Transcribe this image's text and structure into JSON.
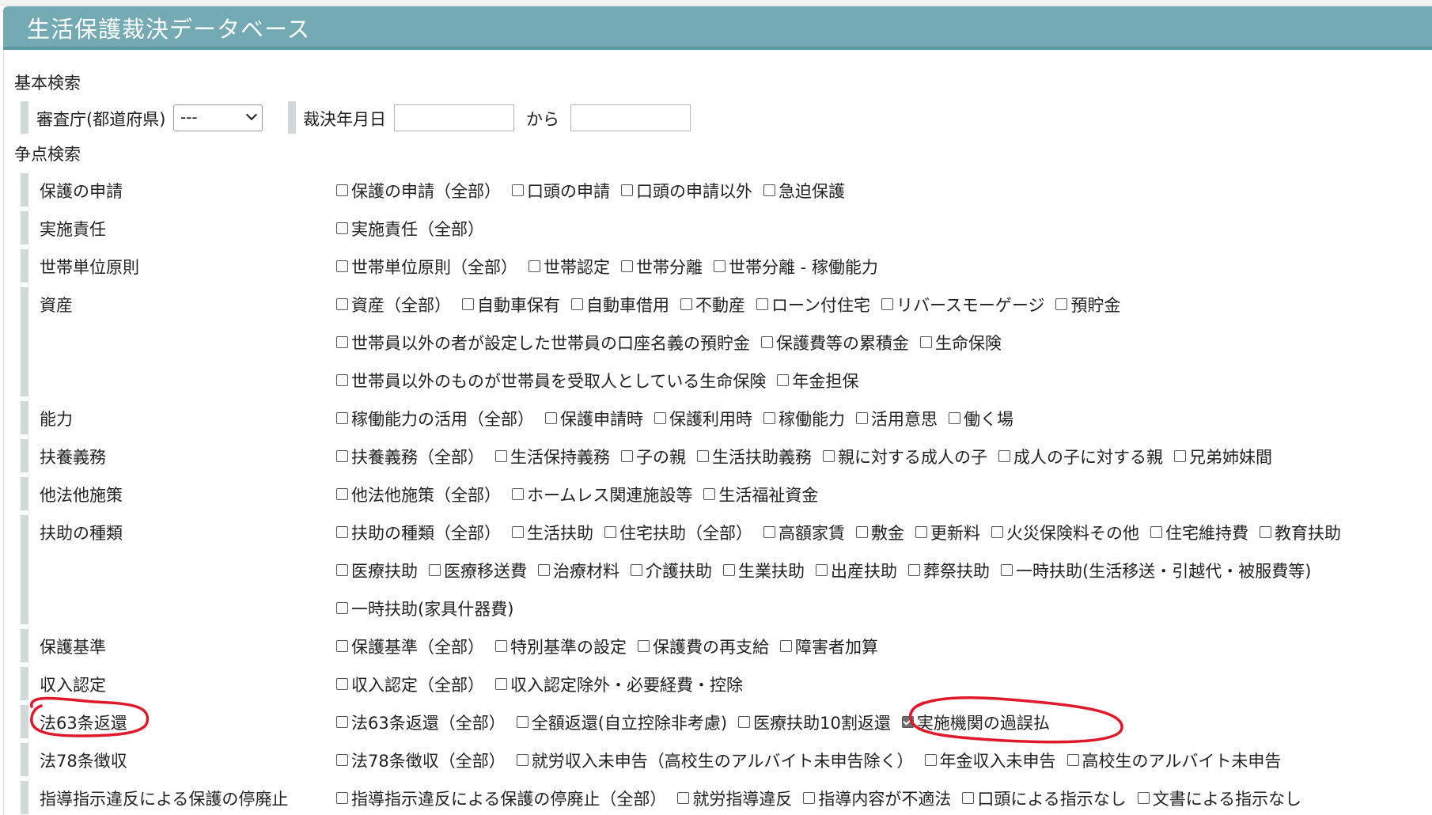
{
  "app": {
    "title": "生活保護裁決データベース"
  },
  "basic_search": {
    "section_label": "基本検索",
    "prefecture": {
      "label": "審査庁(都道府県)",
      "selected": "---"
    },
    "decision_date": {
      "label": "裁決年月日",
      "from_label": "から",
      "start_value": "",
      "end_value": ""
    }
  },
  "issue_search": {
    "section_label": "争点検索",
    "rows": [
      {
        "label": "保護の申請",
        "lines": [
          [
            {
              "text": "保護の申請（全部）",
              "checked": false
            },
            {
              "text": "口頭の申請",
              "checked": false
            },
            {
              "text": "口頭の申請以外",
              "checked": false
            },
            {
              "text": "急迫保護",
              "checked": false
            }
          ]
        ]
      },
      {
        "label": "実施責任",
        "lines": [
          [
            {
              "text": "実施責任（全部）",
              "checked": false
            }
          ]
        ]
      },
      {
        "label": "世帯単位原則",
        "lines": [
          [
            {
              "text": "世帯単位原則（全部）",
              "checked": false
            },
            {
              "text": "世帯認定",
              "checked": false
            },
            {
              "text": "世帯分離",
              "checked": false
            },
            {
              "text": "世帯分離 - 稼働能力",
              "checked": false
            }
          ]
        ]
      },
      {
        "label": "資産",
        "lines": [
          [
            {
              "text": "資産（全部）",
              "checked": false
            },
            {
              "text": "自動車保有",
              "checked": false
            },
            {
              "text": "自動車借用",
              "checked": false
            },
            {
              "text": "不動産",
              "checked": false
            },
            {
              "text": "ローン付住宅",
              "checked": false
            },
            {
              "text": "リバースモーゲージ",
              "checked": false
            },
            {
              "text": "預貯金",
              "checked": false
            }
          ],
          [
            {
              "text": "世帯員以外の者が設定した世帯員の口座名義の預貯金",
              "checked": false
            },
            {
              "text": "保護費等の累積金",
              "checked": false
            },
            {
              "text": "生命保険",
              "checked": false
            }
          ],
          [
            {
              "text": "世帯員以外のものが世帯員を受取人としている生命保険",
              "checked": false
            },
            {
              "text": "年金担保",
              "checked": false
            }
          ]
        ]
      },
      {
        "label": "能力",
        "lines": [
          [
            {
              "text": "稼働能力の活用（全部）",
              "checked": false
            },
            {
              "text": "保護申請時",
              "checked": false
            },
            {
              "text": "保護利用時",
              "checked": false
            },
            {
              "text": "稼働能力",
              "checked": false
            },
            {
              "text": "活用意思",
              "checked": false
            },
            {
              "text": "働く場",
              "checked": false
            }
          ]
        ]
      },
      {
        "label": "扶養義務",
        "lines": [
          [
            {
              "text": "扶養義務（全部）",
              "checked": false
            },
            {
              "text": "生活保持義務",
              "checked": false
            },
            {
              "text": "子の親",
              "checked": false
            },
            {
              "text": "生活扶助義務",
              "checked": false
            },
            {
              "text": "親に対する成人の子",
              "checked": false
            },
            {
              "text": "成人の子に対する親",
              "checked": false
            },
            {
              "text": "兄弟姉妹間",
              "checked": false
            }
          ]
        ]
      },
      {
        "label": "他法他施策",
        "lines": [
          [
            {
              "text": "他法他施策（全部）",
              "checked": false
            },
            {
              "text": "ホームレス関連施設等",
              "checked": false
            },
            {
              "text": "生活福祉資金",
              "checked": false
            }
          ]
        ]
      },
      {
        "label": "扶助の種類",
        "lines": [
          [
            {
              "text": "扶助の種類（全部）",
              "checked": false
            },
            {
              "text": "生活扶助",
              "checked": false
            },
            {
              "text": "住宅扶助（全部）",
              "checked": false
            },
            {
              "text": "高額家賃",
              "checked": false
            },
            {
              "text": "敷金",
              "checked": false
            },
            {
              "text": "更新料",
              "checked": false
            },
            {
              "text": "火災保険料その他",
              "checked": false
            },
            {
              "text": "住宅維持費",
              "checked": false
            },
            {
              "text": "教育扶助",
              "checked": false
            }
          ],
          [
            {
              "text": "医療扶助",
              "checked": false
            },
            {
              "text": "医療移送費",
              "checked": false
            },
            {
              "text": "治療材料",
              "checked": false
            },
            {
              "text": "介護扶助",
              "checked": false
            },
            {
              "text": "生業扶助",
              "checked": false
            },
            {
              "text": "出産扶助",
              "checked": false
            },
            {
              "text": "葬祭扶助",
              "checked": false
            },
            {
              "text": "一時扶助(生活移送・引越代・被服費等)",
              "checked": false
            }
          ],
          [
            {
              "text": "一時扶助(家具什器費)",
              "checked": false
            }
          ]
        ]
      },
      {
        "label": "保護基準",
        "lines": [
          [
            {
              "text": "保護基準（全部）",
              "checked": false
            },
            {
              "text": "特別基準の設定",
              "checked": false
            },
            {
              "text": "保護費の再支給",
              "checked": false
            },
            {
              "text": "障害者加算",
              "checked": false
            }
          ]
        ]
      },
      {
        "label": "収入認定",
        "lines": [
          [
            {
              "text": "収入認定（全部）",
              "checked": false
            },
            {
              "text": "収入認定除外・必要経費・控除",
              "checked": false
            }
          ]
        ]
      },
      {
        "label": "法63条返還",
        "lines": [
          [
            {
              "text": "法63条返還（全部）",
              "checked": false
            },
            {
              "text": "全額返還(自立控除非考慮)",
              "checked": false
            },
            {
              "text": "医療扶助10割返還",
              "checked": false
            },
            {
              "text": "実施機関の過誤払",
              "checked": true
            }
          ]
        ]
      },
      {
        "label": "法78条徴収",
        "lines": [
          [
            {
              "text": "法78条徴収（全部）",
              "checked": false
            },
            {
              "text": "就労収入未申告（高校生のアルバイト未申告除く）",
              "checked": false
            },
            {
              "text": "年金収入未申告",
              "checked": false
            },
            {
              "text": "高校生のアルバイト未申告",
              "checked": false
            }
          ]
        ]
      },
      {
        "label": "指導指示違反による保護の停廃止",
        "lines": [
          [
            {
              "text": "指導指示違反による保護の停廃止（全部）",
              "checked": false
            },
            {
              "text": "就労指導違反",
              "checked": false
            },
            {
              "text": "指導内容が不適法",
              "checked": false
            },
            {
              "text": "口頭による指示なし",
              "checked": false
            },
            {
              "text": "文書による指示なし",
              "checked": false
            }
          ]
        ]
      }
    ]
  },
  "colors": {
    "header": "#73aab3",
    "bar": "#d3d8da",
    "annotation": "#e0192a"
  }
}
